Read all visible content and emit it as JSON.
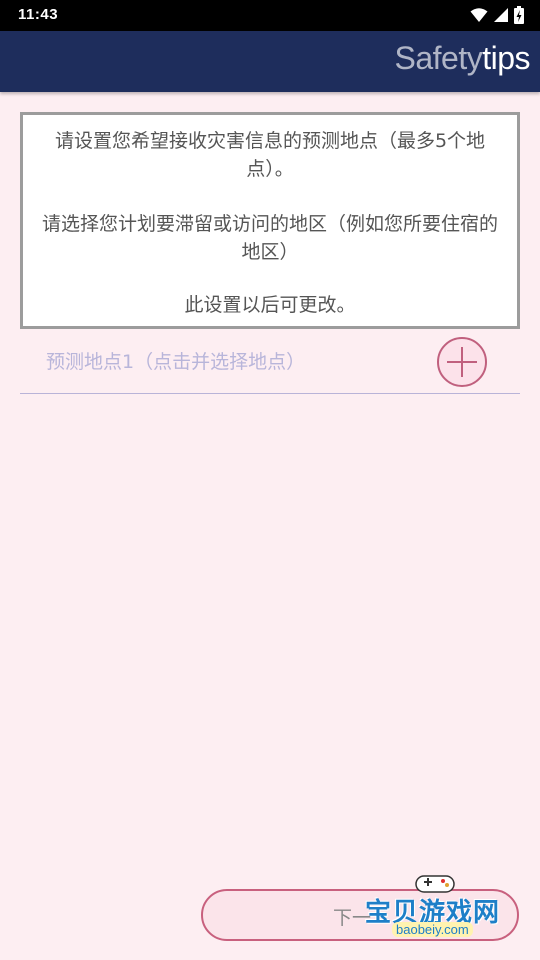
{
  "status_bar": {
    "time": "11:43",
    "icons": [
      "wifi-icon",
      "signal-icon",
      "battery-charging-icon"
    ]
  },
  "app_bar": {
    "title_light": "Safety",
    "title_bold": "tips"
  },
  "info": {
    "paragraph1": "请设置您希望接收灾害信息的预测地点（最多5个地点）。",
    "paragraph2": "请选择您计划要滞留或访问的地区（例如您所要住宿的地区）",
    "paragraph3": "此设置以后可更改。"
  },
  "locations": [
    {
      "label": "预测地点1（点击并选择地点）",
      "action_icon": "plus-icon"
    }
  ],
  "next_button": {
    "label": "下一"
  },
  "watermark": {
    "text": "宝贝游戏网",
    "domain": "baobeiy.com"
  },
  "colors": {
    "app_bar_bg": "#1e2d5c",
    "page_bg": "#fdeef2",
    "accent": "#c0607e",
    "placeholder": "#b8b5da"
  }
}
